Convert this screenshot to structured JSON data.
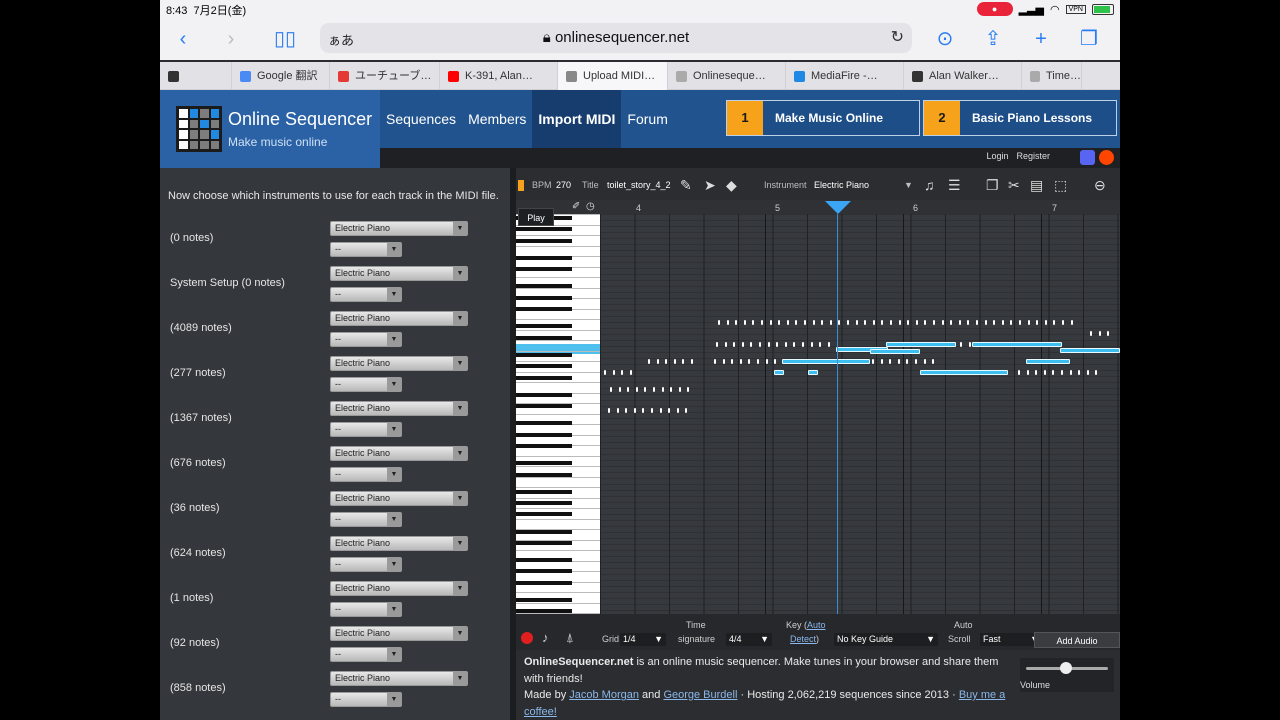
{
  "status": {
    "time": "8:43",
    "date": "7月2日(金)",
    "vpn": "VPN"
  },
  "browser": {
    "reader": "ぁあ",
    "url": "onlinesequencer.net",
    "tabs": [
      {
        "label": "",
        "color": "#333"
      },
      {
        "label": "Google 翻訳",
        "color": "#4a8af4"
      },
      {
        "label": "ユーチューブ…",
        "color": "#e53935"
      },
      {
        "label": "K-391, Alan…",
        "color": "#ff0000"
      },
      {
        "label": "Upload MIDI…",
        "color": "#888"
      },
      {
        "label": "Onlineseque…",
        "color": "#aaa"
      },
      {
        "label": "MediaFire -…",
        "color": "#1e88e5"
      },
      {
        "label": "Alan Walker…",
        "color": "#333"
      },
      {
        "label": "Time…",
        "color": "#aaa"
      }
    ]
  },
  "site": {
    "name": "Online Sequencer",
    "tagline": "Make music online",
    "nav": [
      "Sequences",
      "Members",
      "Import MIDI",
      "Forum"
    ],
    "promo1": {
      "num": "1",
      "label": "Make Music Online"
    },
    "promo2": {
      "num": "2",
      "label": "Basic Piano Lessons"
    },
    "login": "Login",
    "register": "Register"
  },
  "left": {
    "intro": "Now choose which instruments to use for each track in the MIDI file.",
    "instrument": "Electric Piano",
    "second": "--",
    "tracks": [
      "(0 notes)",
      "System Setup (0 notes)",
      "(4089 notes)",
      "(277 notes)",
      "(1367 notes)",
      "(676 notes)",
      "(36 notes)",
      "(624 notes)",
      "(1 notes)",
      "(92 notes)",
      "(858 notes)"
    ]
  },
  "seq": {
    "bpm_label": "BPM",
    "bpm": "270",
    "title_label": "Title",
    "title": "toilet_story_4_2",
    "instrument_label": "Instrument",
    "instrument": "Electric Piano",
    "play": "Play",
    "measures": [
      "4",
      "5",
      "6",
      "7"
    ]
  },
  "controls": {
    "grid_label": "Grid",
    "grid": "1/4",
    "time_label": "Time",
    "sig_label": "signature",
    "sig": "4/4",
    "key_label": "Key (",
    "key_auto": "Auto",
    "key_detect": "Detect",
    "key_close": ")",
    "key_guide": "No Key Guide",
    "auto_label": "Auto",
    "scroll_label": "Scroll",
    "scroll": "Fast",
    "add_audio": "Add Audio"
  },
  "about": {
    "site": "OnlineSequencer.net",
    "line1": " is an online music sequencer. Make tunes in your browser and share them with friends!",
    "made_by": "Made by ",
    "author1": "Jacob Morgan",
    "and": " and ",
    "author2": "George Burdell",
    "hosting": " · Hosting 2,062,219 sequences since 2013 · ",
    "coffee": "Buy me a coffee!"
  },
  "volume_label": "Volume"
}
